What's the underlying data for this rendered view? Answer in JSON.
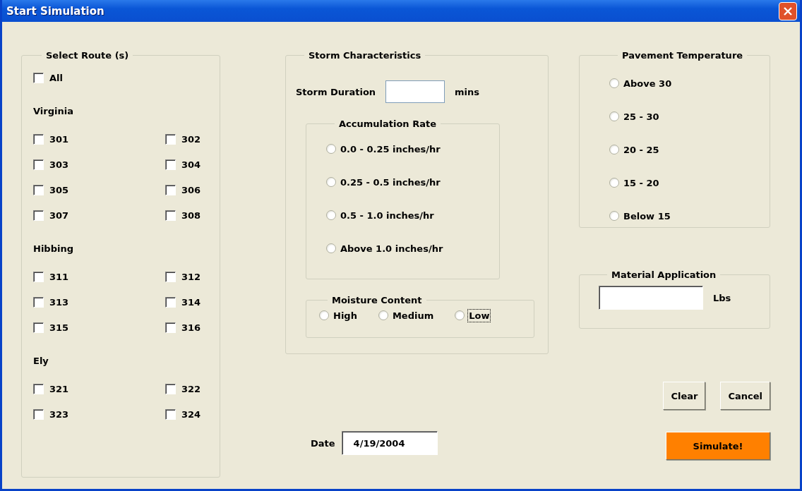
{
  "window": {
    "title": "Start Simulation"
  },
  "routes": {
    "title": "Select Route (s)",
    "all": {
      "label": "All",
      "checked": false
    },
    "groups": [
      {
        "name": "Virginia",
        "routes": [
          {
            "label": "301",
            "checked": false
          },
          {
            "label": "302",
            "checked": false
          },
          {
            "label": "303",
            "checked": false
          },
          {
            "label": "304",
            "checked": false
          },
          {
            "label": "305",
            "checked": false
          },
          {
            "label": "306",
            "checked": false
          },
          {
            "label": "307",
            "checked": false
          },
          {
            "label": "308",
            "checked": false
          }
        ]
      },
      {
        "name": "Hibbing",
        "routes": [
          {
            "label": "311",
            "checked": false
          },
          {
            "label": "312",
            "checked": false
          },
          {
            "label": "313",
            "checked": false
          },
          {
            "label": "314",
            "checked": false
          },
          {
            "label": "315",
            "checked": false
          },
          {
            "label": "316",
            "checked": false
          }
        ]
      },
      {
        "name": "Ely",
        "routes": [
          {
            "label": "321",
            "checked": false
          },
          {
            "label": "322",
            "checked": false
          },
          {
            "label": "323",
            "checked": false
          },
          {
            "label": "324",
            "checked": false
          }
        ]
      }
    ]
  },
  "storm": {
    "title": "Storm Characteristics",
    "duration_label": "Storm Duration",
    "duration_unit": "mins",
    "accumulation": {
      "title": "Accumulation Rate",
      "options": [
        {
          "label": "0.0 - 0.25 inches/hr",
          "selected": false
        },
        {
          "label": "0.25 - 0.5 inches/hr",
          "selected": false
        },
        {
          "label": "0.5 - 1.0 inches/hr",
          "selected": false
        },
        {
          "label": "Above 1.0 inches/hr",
          "selected": false
        }
      ]
    },
    "moisture": {
      "title": "Moisture Content",
      "options": [
        {
          "label": "High",
          "selected": false,
          "focused": false
        },
        {
          "label": "Medium",
          "selected": false,
          "focused": false
        },
        {
          "label": "Low",
          "selected": false,
          "focused": true
        }
      ]
    }
  },
  "date": {
    "label": "Date",
    "value": "4/19/2004"
  },
  "pavement": {
    "title": "Pavement Temperature",
    "options": [
      {
        "label": "Above 30",
        "selected": false
      },
      {
        "label": "25 - 30",
        "selected": false
      },
      {
        "label": "20 - 25",
        "selected": false
      },
      {
        "label": "15 - 20",
        "selected": false
      },
      {
        "label": "Below 15",
        "selected": false
      }
    ]
  },
  "material": {
    "title": "Material Application",
    "unit": "Lbs"
  },
  "buttons": [
    {
      "label": "Clear",
      "kind": "normal"
    },
    {
      "label": "Cancel",
      "kind": "normal"
    },
    {
      "label": "Simulate!",
      "kind": "primary"
    }
  ]
}
